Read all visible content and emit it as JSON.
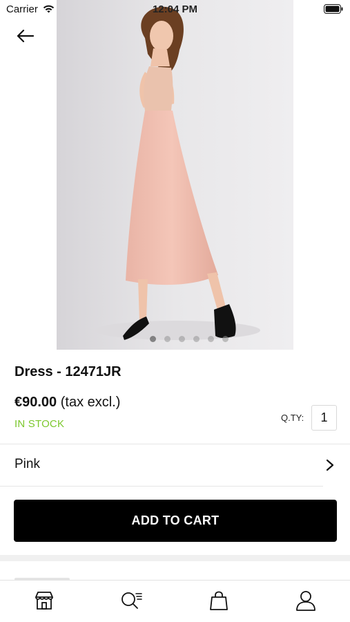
{
  "status_bar": {
    "carrier": "Carrier",
    "time": "12:04 PM",
    "icons": [
      "wifi-icon",
      "battery-icon"
    ]
  },
  "navigation": {
    "back_icon": "arrow-left-icon"
  },
  "gallery": {
    "image_count": 6,
    "active_index": 0,
    "background": "#e9e8ea",
    "dress_color": "#f2c1b3"
  },
  "product": {
    "title": "Dress - 12471JR",
    "price": "€90.00",
    "tax_note": "(tax excl.)",
    "stock_status": "IN STOCK",
    "stock_color": "#7cc82d"
  },
  "quantity": {
    "label": "Q.TY:",
    "value": "1"
  },
  "variant": {
    "label": "Pink",
    "icon": "chevron-right-icon"
  },
  "actions": {
    "add_to_cart_label": "ADD TO CART",
    "button_color": "#000000"
  },
  "tab_bar": {
    "items": [
      {
        "icon": "store-icon"
      },
      {
        "icon": "search-list-icon"
      },
      {
        "icon": "shopping-bag-icon"
      },
      {
        "icon": "user-icon"
      }
    ]
  }
}
